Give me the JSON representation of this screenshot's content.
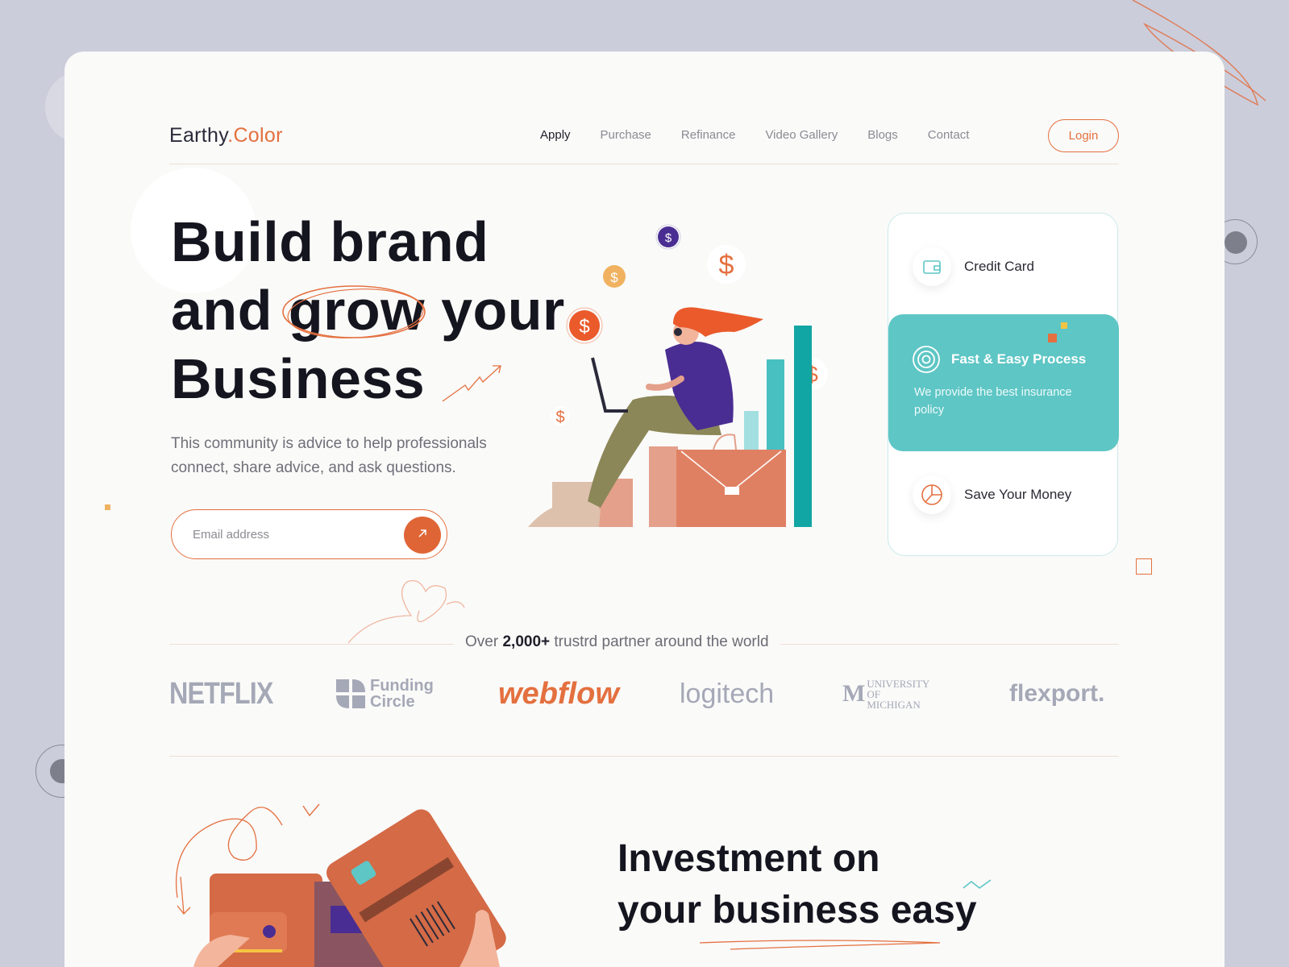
{
  "brand": {
    "name": "Earthy",
    "dot_suffix": ".Color",
    "accent": "#e4703f"
  },
  "nav": {
    "items": [
      {
        "label": "Apply",
        "active": true
      },
      {
        "label": "Purchase"
      },
      {
        "label": "Refinance"
      },
      {
        "label": "Video Gallery"
      },
      {
        "label": "Blogs"
      },
      {
        "label": "Contact"
      }
    ],
    "login_label": "Login"
  },
  "hero": {
    "title_line1": "Build brand",
    "title_line2_a": "and",
    "title_line2_circled": "grow",
    "title_line2_bold": "your",
    "title_line3_bold": "Business",
    "description": "This community is advice to help professionals connect, share advice, and ask questions.",
    "email_placeholder": "Email address",
    "submit_icon": "arrow-up-right-icon"
  },
  "features": [
    {
      "label": "Credit Card",
      "icon": "wallet-icon"
    },
    {
      "label": "Fast & Easy Process",
      "icon": "target-icon",
      "active": true,
      "description": "We provide the best insurance policy"
    },
    {
      "label": "Save Your Money",
      "icon": "pie-chart-icon"
    }
  ],
  "partners": {
    "prefix": "Over",
    "count": "2,000+",
    "suffix": "trustrd partner around the world",
    "logos": [
      "NETFLIX",
      "Funding Circle",
      "webflow",
      "logitech",
      "UNIVERSITY OF MICHIGAN",
      "flexport."
    ]
  },
  "investment": {
    "line1": "Investment on",
    "line2_light": "your",
    "line2_bold": "business easy"
  },
  "colors": {
    "orange": "#e4703f",
    "teal": "#5ec6c5",
    "purple": "#4a2d92",
    "background": "#cbcdda"
  }
}
